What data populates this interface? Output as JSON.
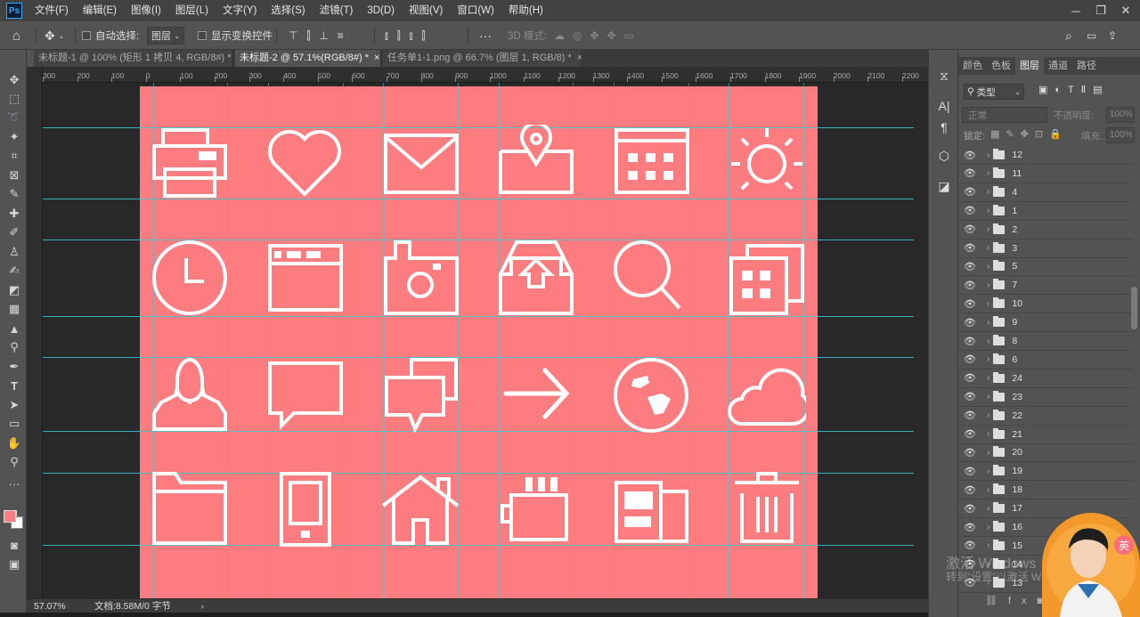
{
  "app": {
    "name": "Ps"
  },
  "menu": [
    "文件(F)",
    "编辑(E)",
    "图像(I)",
    "图层(L)",
    "文字(Y)",
    "选择(S)",
    "滤镜(T)",
    "3D(D)",
    "视图(V)",
    "窗口(W)",
    "帮助(H)"
  ],
  "options": {
    "auto_select_label": "自动选择:",
    "auto_select_value": "图层",
    "show_transform_label": "显示变换控件",
    "mode_3d_label": "3D 模式:"
  },
  "tabs": [
    {
      "label": "未标题-1 @ 100% (矩形 1 拷贝 4, RGB/8#) *",
      "close": "×"
    },
    {
      "label": "未标题-2 @ 57.1%(RGB/8#) *",
      "close": "×"
    },
    {
      "label": "任务单1-1.png @ 66.7% (图层 1, RGB/8) *",
      "close": "×"
    }
  ],
  "ruler": {
    "labels": [
      "300",
      "200",
      "100",
      "0",
      "100",
      "200",
      "300",
      "400",
      "500",
      "600",
      "700",
      "800",
      "900",
      "1000",
      "1100",
      "1200",
      "1300",
      "1400",
      "1500",
      "1600",
      "1700",
      "1800",
      "1900",
      "2000",
      "2100",
      "2200"
    ]
  },
  "status": {
    "zoom": "57.07%",
    "doc": "文档:8.58M/0 字节"
  },
  "panel": {
    "tabs": [
      "颜色",
      "色板",
      "图层",
      "通道",
      "路径"
    ],
    "active_tab": "图层",
    "filter_kind": "类型",
    "blend_mode": "正常",
    "opacity_label": "不透明度:",
    "opacity_value": "100%",
    "lock_label": "锁定:",
    "fill_label": "填充:",
    "fill_value": "100%",
    "layers": [
      "12",
      "11",
      "4",
      "1",
      "2",
      "3",
      "5",
      "7",
      "10",
      "9",
      "8",
      "6",
      "24",
      "23",
      "22",
      "21",
      "20",
      "19",
      "18",
      "17",
      "16",
      "15",
      "14",
      "13"
    ]
  },
  "watermark": {
    "line1": "激活 Windows",
    "line2": "转到\"设置\"以激活 Windows"
  },
  "colors": {
    "artboard": "#fd7c7f",
    "guide": "#37c9ce",
    "icon_stroke": "#ffffff",
    "foreground": "#fd7c7f",
    "background": "#ffffff"
  },
  "icons": [
    "printer-icon",
    "heart-icon",
    "mail-icon",
    "map-pin-icon",
    "calendar-icon",
    "sun-icon",
    "clock-icon",
    "browser-window-icon",
    "camera-icon",
    "inbox-upload-icon",
    "search-icon",
    "apps-grid-icon",
    "user-icon",
    "chat-bubble-icon",
    "chat-multiple-icon",
    "arrow-right-icon",
    "globe-icon",
    "cloud-icon",
    "folder-icon",
    "mobile-phone-icon",
    "home-icon",
    "coffee-mug-icon",
    "newspaper-icon",
    "trash-icon"
  ]
}
